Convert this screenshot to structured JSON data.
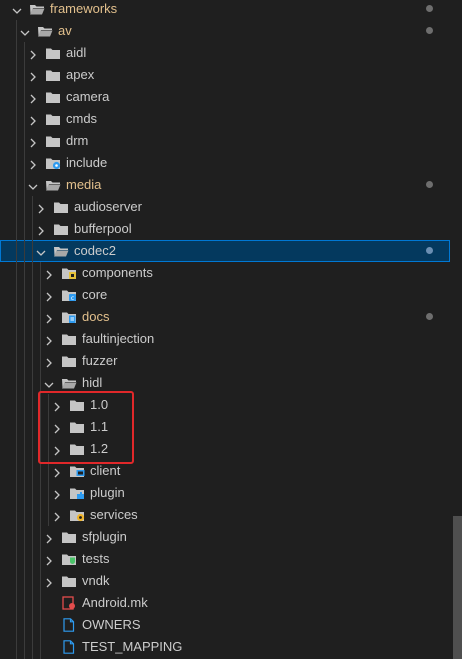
{
  "explorer": {
    "colors": {
      "background": "#1f1f1f",
      "text": "#cccccc",
      "modified_text": "#e2c08d",
      "selection": "#04395e",
      "selection_border": "#0078d4",
      "highlight_box": "#e0282a",
      "folder_icon": "#c5c5c5"
    },
    "items": [
      {
        "label": "frameworks",
        "depth": 0,
        "type": "folder",
        "expanded": true,
        "icon": "folder-open-icon",
        "modified": true,
        "dot": true
      },
      {
        "label": "av",
        "depth": 1,
        "type": "folder",
        "expanded": true,
        "icon": "folder-open-icon",
        "modified": true,
        "dot": true
      },
      {
        "label": "aidl",
        "depth": 2,
        "type": "folder",
        "expanded": false,
        "icon": "folder-icon"
      },
      {
        "label": "apex",
        "depth": 2,
        "type": "folder",
        "expanded": false,
        "icon": "folder-icon"
      },
      {
        "label": "camera",
        "depth": 2,
        "type": "folder",
        "expanded": false,
        "icon": "folder-icon"
      },
      {
        "label": "cmds",
        "depth": 2,
        "type": "folder",
        "expanded": false,
        "icon": "folder-icon"
      },
      {
        "label": "drm",
        "depth": 2,
        "type": "folder",
        "expanded": false,
        "icon": "folder-icon"
      },
      {
        "label": "include",
        "depth": 2,
        "type": "folder",
        "expanded": false,
        "icon": "folder-include-icon"
      },
      {
        "label": "media",
        "depth": 2,
        "type": "folder",
        "expanded": true,
        "icon": "folder-open-icon",
        "modified": true,
        "dot": true
      },
      {
        "label": "audioserver",
        "depth": 3,
        "type": "folder",
        "expanded": false,
        "icon": "folder-icon"
      },
      {
        "label": "bufferpool",
        "depth": 3,
        "type": "folder",
        "expanded": false,
        "icon": "folder-icon"
      },
      {
        "label": "codec2",
        "depth": 3,
        "type": "folder",
        "expanded": true,
        "icon": "folder-open-icon",
        "selected": true,
        "dot": true
      },
      {
        "label": "components",
        "depth": 4,
        "type": "folder",
        "expanded": false,
        "icon": "folder-components-icon"
      },
      {
        "label": "core",
        "depth": 4,
        "type": "folder",
        "expanded": false,
        "icon": "folder-core-icon"
      },
      {
        "label": "docs",
        "depth": 4,
        "type": "folder",
        "expanded": false,
        "icon": "folder-docs-icon",
        "modified": true,
        "dot": true
      },
      {
        "label": "faultinjection",
        "depth": 4,
        "type": "folder",
        "expanded": false,
        "icon": "folder-icon"
      },
      {
        "label": "fuzzer",
        "depth": 4,
        "type": "folder",
        "expanded": false,
        "icon": "folder-icon"
      },
      {
        "label": "hidl",
        "depth": 4,
        "type": "folder",
        "expanded": true,
        "icon": "folder-open-icon"
      },
      {
        "label": "1.0",
        "depth": 5,
        "type": "folder",
        "expanded": false,
        "icon": "folder-icon"
      },
      {
        "label": "1.1",
        "depth": 5,
        "type": "folder",
        "expanded": false,
        "icon": "folder-icon"
      },
      {
        "label": "1.2",
        "depth": 5,
        "type": "folder",
        "expanded": false,
        "icon": "folder-icon"
      },
      {
        "label": "client",
        "depth": 5,
        "type": "folder",
        "expanded": false,
        "icon": "folder-client-icon"
      },
      {
        "label": "plugin",
        "depth": 5,
        "type": "folder",
        "expanded": false,
        "icon": "folder-plugin-icon"
      },
      {
        "label": "services",
        "depth": 5,
        "type": "folder",
        "expanded": false,
        "icon": "folder-services-icon"
      },
      {
        "label": "sfplugin",
        "depth": 4,
        "type": "folder",
        "expanded": false,
        "icon": "folder-icon"
      },
      {
        "label": "tests",
        "depth": 4,
        "type": "folder",
        "expanded": false,
        "icon": "folder-tests-icon"
      },
      {
        "label": "vndk",
        "depth": 4,
        "type": "folder",
        "expanded": false,
        "icon": "folder-icon"
      },
      {
        "label": "Android.mk",
        "depth": 4,
        "type": "file",
        "icon": "makefile-icon"
      },
      {
        "label": "OWNERS",
        "depth": 4,
        "type": "file",
        "icon": "file-icon"
      },
      {
        "label": "TEST_MAPPING",
        "depth": 4,
        "type": "file",
        "icon": "file-icon"
      }
    ]
  }
}
